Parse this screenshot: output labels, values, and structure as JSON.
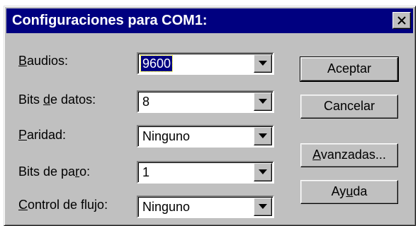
{
  "window": {
    "title": "Configuraciones para COM1:"
  },
  "fields": [
    {
      "label_pre": "",
      "label_key": "B",
      "label_post": "audios:",
      "value": "9600"
    },
    {
      "label_pre": "Bits ",
      "label_key": "d",
      "label_post": "e datos:",
      "value": "8"
    },
    {
      "label_pre": "",
      "label_key": "P",
      "label_post": "aridad:",
      "value": "Ninguno"
    },
    {
      "label_pre": "Bits de pa",
      "label_key": "r",
      "label_post": "o:",
      "value": "1"
    },
    {
      "label_pre": "",
      "label_key": "C",
      "label_post": "ontrol de flujo:",
      "value": "Ninguno"
    }
  ],
  "buttons": {
    "accept": {
      "text": "Aceptar"
    },
    "cancel": {
      "text": "Cancelar"
    },
    "advanced": {
      "pre": "",
      "key": "A",
      "post": "vanzadas..."
    },
    "help": {
      "pre": "Ay",
      "key": "u",
      "post": "da"
    }
  },
  "icons": {
    "close": "close-icon",
    "dropdown": "chevron-down-icon"
  },
  "colors": {
    "titlebar": "#000080",
    "face": "#c0c0c0",
    "selection": "#000080"
  }
}
